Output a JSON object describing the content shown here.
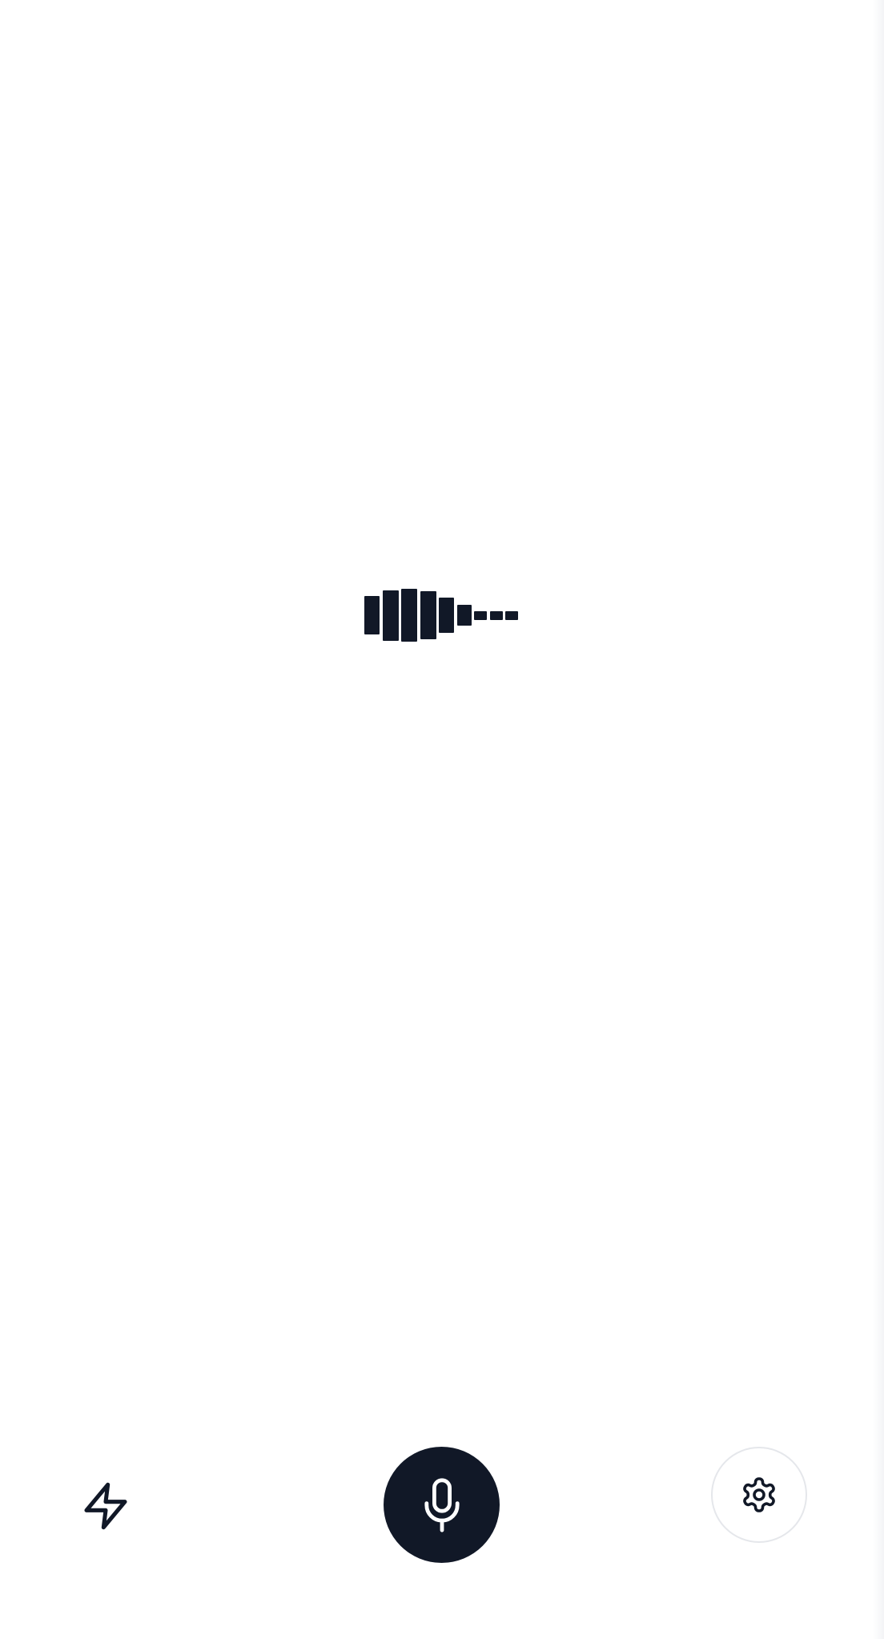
{
  "app": {
    "background": "#ffffff",
    "accent": "#111827"
  },
  "waveform": {
    "state": "listening",
    "levels": [
      0.55,
      0.72,
      0.75,
      0.68,
      0.5,
      0.3,
      0.12,
      0.12,
      0.12
    ]
  },
  "bottom_bar": {
    "quick_button": {
      "icon": "lightning-bolt-icon"
    },
    "mic_button": {
      "icon": "microphone-icon"
    },
    "settings_button": {
      "icon": "gear-icon"
    }
  }
}
